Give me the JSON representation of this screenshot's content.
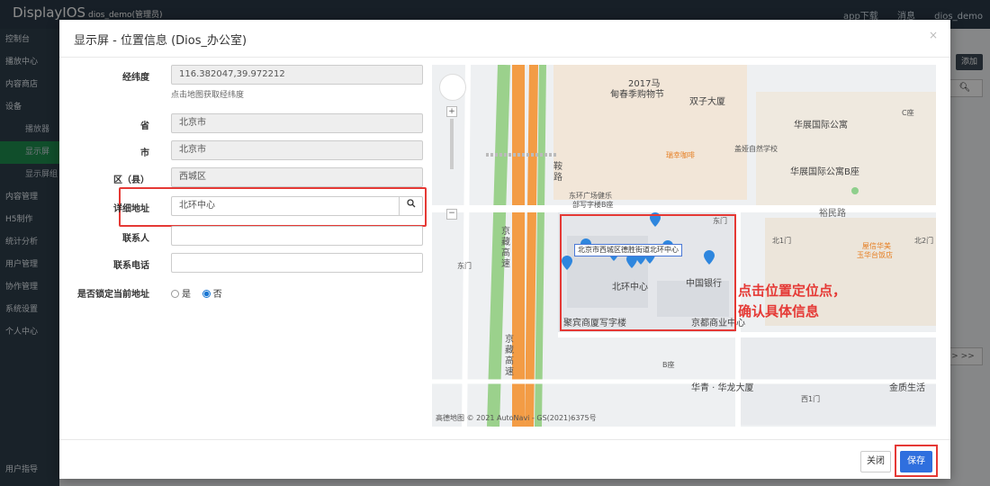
{
  "app": {
    "brand": "DisplayIOS",
    "brand_sub": "dios_demo(管理员)",
    "top_links": [
      "app下载",
      "消息",
      "dios_demo"
    ]
  },
  "sidebar": {
    "items": [
      {
        "label": "控制台"
      },
      {
        "label": "播放中心"
      },
      {
        "label": "内容商店"
      },
      {
        "label": "设备"
      },
      {
        "label": "播放器",
        "sub": true
      },
      {
        "label": "显示屏",
        "sub": true,
        "active": true
      },
      {
        "label": "显示屏组",
        "sub": true
      },
      {
        "label": "内容管理"
      },
      {
        "label": "H5制作"
      },
      {
        "label": "统计分析"
      },
      {
        "label": "用户管理"
      },
      {
        "label": "协作管理"
      },
      {
        "label": "系统设置"
      },
      {
        "label": "个人中心"
      }
    ],
    "bottom": "用户指导"
  },
  "background": {
    "add_button": "添加",
    "pager": ">  >>"
  },
  "modal": {
    "title": "显示屏 - 位置信息  (Dios_办公室)",
    "close": "×",
    "fields": {
      "latlng_label": "经纬度",
      "latlng_value": "116.382047,39.972212",
      "latlng_hint": "点击地图获取经纬度",
      "province_label": "省",
      "province_value": "北京市",
      "city_label": "市",
      "city_value": "北京市",
      "district_label": "区（县）",
      "district_value": "西城区",
      "address_label": "详细地址",
      "address_value": "北环中心",
      "contact_label": "联系人",
      "contact_value": "",
      "phone_label": "联系电话",
      "phone_value": "",
      "lock_label": "是否锁定当前地址",
      "lock_yes": "是",
      "lock_no": "否",
      "lock_selected": "否"
    },
    "footer": {
      "close_label": "关闭",
      "save_label": "保存"
    }
  },
  "map": {
    "labels": {
      "l2017": "2017马",
      "mall": "甸春季购物节",
      "twin": "双子大厦",
      "huazhan": "华展国际公寓",
      "huazhan_b": "华展国际公寓B座",
      "cafe": "瑞幸咖啡",
      "forest": "盖娅自然学校",
      "c_seat": "C座",
      "north_ring": "东环广场健乐",
      "office_b": "部写字楼B座",
      "yumin": "裕民路",
      "beijing_bank": "中国银行",
      "center": "北环中心",
      "jufu": "聚宾商厦写字楼",
      "jingdu": "京都商业中心",
      "xihai": "屋信华美",
      "yuhua": "玉华台饭店",
      "huayi": "华青 · 华龙大厦",
      "jinzhi": "金质生活",
      "road_jingzang": "京藏高速",
      "road_jingzang2": "京藏高速",
      "road_e": "鞍路",
      "north_gate": "北1门",
      "north2": "北2门",
      "east_gate": "东门",
      "west_gate": "西1门",
      "b_seat": "B座",
      "popup": "北京市西城区德胜街道北环中心"
    },
    "annotation_line1": "点击位置定位点，",
    "annotation_line2": "确认具体信息",
    "attribution": "高德地图 © 2021 AutoNavi - GS(2021)6375号"
  },
  "colors": {
    "accent": "#2f6fde",
    "annotation_red": "#e53935",
    "sidebar_active": "#1e8e4f",
    "pin_blue": "#2e86de",
    "road_orange": "#f39c45"
  }
}
